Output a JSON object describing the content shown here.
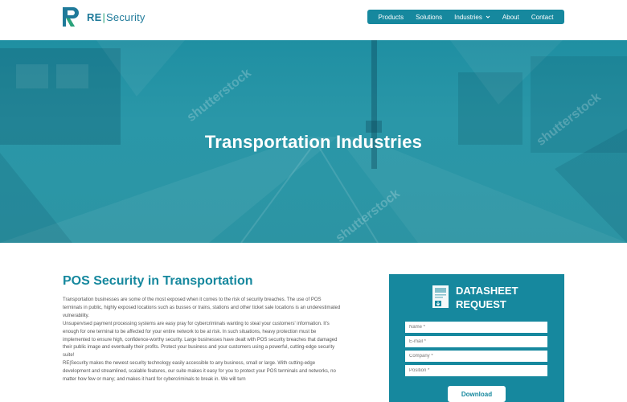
{
  "brand": {
    "name_left": "RE",
    "separator": "|",
    "name_right": "Security",
    "colors": {
      "primary": "#16889e",
      "accent": "#2aa37a"
    }
  },
  "nav": {
    "items": [
      "Products",
      "Solutions",
      "Industries",
      "About",
      "Contact"
    ]
  },
  "hero": {
    "title": "Transportation Industries",
    "watermark": "shutterstock"
  },
  "main": {
    "heading": "POS Security in Transportation",
    "paragraphs": [
      "Transportation businesses are some of the most exposed when it comes to the risk of security breaches. The use of POS terminals in public, highly exposed locations such as busses or trains, stations and other ticket sale locations is an underestimated vulnerability.",
      "Unsupervised payment processing systems are easy pray for cybercriminals wanting to steal your customers' information. It's enough for one terminal to be affected for your entire network to be at risk. In such situations, heavy protection must be implemented to ensure high, confidence-worthy security. Large businesses have dealt with POS security breaches that damaged their public image and eventually their profits. Protect your business and your customers using a powerful, cutting-edge security suite!",
      "RE|Security makes the newest security technology easily accessible to any business, small or large. With cutting-edge development and streamlined, scalable features, our suite makes it easy for you to protect your POS terminals and networks, no matter how few or many; and makes it hard for cybercriminals to break in. We will turn"
    ]
  },
  "datasheet": {
    "title_line1": "DATASHEET",
    "title_line2": "REQUEST",
    "fields": [
      {
        "placeholder": "Name *"
      },
      {
        "placeholder": "E-mail *"
      },
      {
        "placeholder": "Company *"
      },
      {
        "placeholder": "Position *"
      }
    ],
    "button_label": "Download"
  }
}
